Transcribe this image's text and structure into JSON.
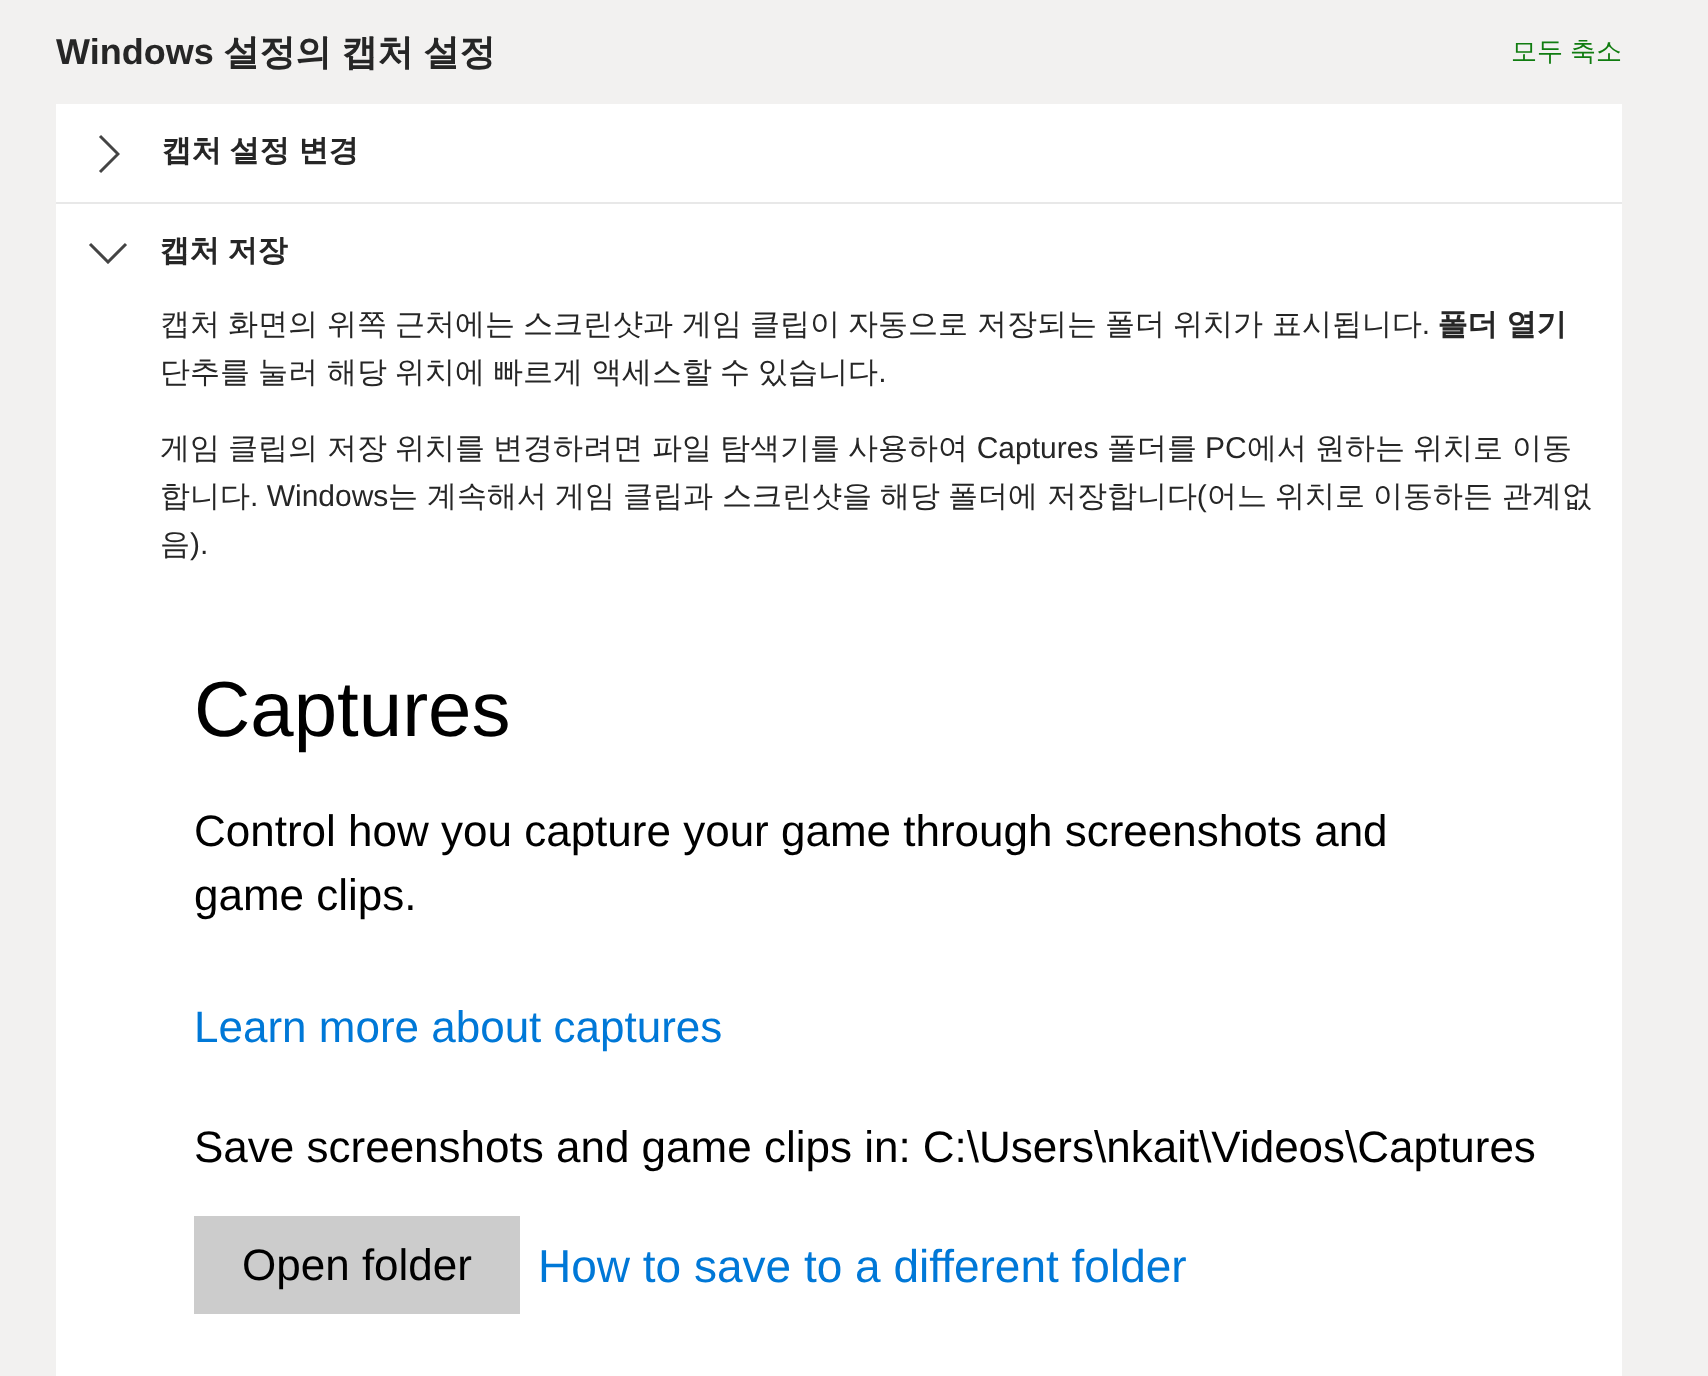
{
  "header": {
    "title": "Windows 설정의 캡처 설정",
    "collapse_all": "모두 축소"
  },
  "sections": [
    {
      "title": "캡처 설정 변경",
      "expanded": false
    },
    {
      "title": "캡처 저장",
      "expanded": true,
      "paragraphs": [
        "캡처 화면의 위쪽 근처에는 스크린샷과 게임 클립이 자동으로 저장되는 폴더 위치가 표시됩니다. **폴더 열기** 단추를 눌러 해당 위치에 빠르게 액세스할 수 있습니다.",
        "게임 클립의 저장 위치를 변경하려면 파일 탐색기를 사용하여 Captures 폴더를 PC에서 원하는 위치로 이동합니다. Windows는 계속해서 게임 클립과 스크린샷을 해당 폴더에 저장합니다(어느 위치로 이동하든 관계없음)."
      ],
      "screenshot": {
        "title": "Captures",
        "description": "Control how you capture your game through screenshots and game clips.",
        "learn_more_link": "Learn more about captures",
        "save_location": "Save screenshots and game clips in: C:\\Users\\nkait\\Videos\\Captures",
        "open_folder_button": "Open folder",
        "different_folder_link": "How to save to a different folder"
      }
    }
  ]
}
